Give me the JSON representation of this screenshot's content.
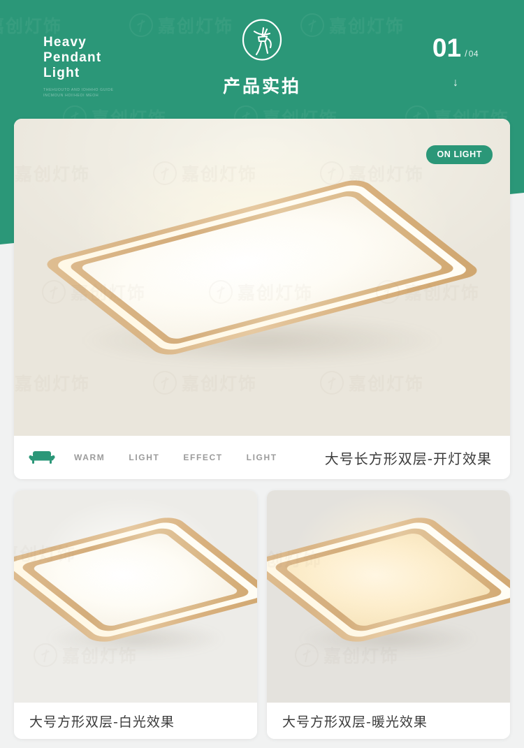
{
  "header": {
    "brand_lines": [
      "Heavy",
      "Pendant",
      "Light"
    ],
    "brand_subtitle": "THEHUOUTO AND IOHHHO GUIDE INCMOUN HOIIHEOI MEOH",
    "center_title": "产品实拍",
    "logo_icon": "circle-deer-logo-icon",
    "pager_current": "01",
    "pager_separator": "/",
    "pager_total": "04",
    "scroll_arrow": "↓",
    "bg_color": "#2b9778"
  },
  "watermark": {
    "text": "嘉创灯饰",
    "icon": "circle-deer-logo-icon"
  },
  "main_card": {
    "badge": "ON LIGHT",
    "sofa_icon": "sofa-icon",
    "keywords": [
      "WARM",
      "LIGHT",
      "EFFECT",
      "LIGHT"
    ],
    "caption": "大号长方形双层-开灯效果",
    "lamp_type": "rectangular-double-layer-wood-ceiling-lamp",
    "light_state": "on"
  },
  "gallery": [
    {
      "caption": "大号方形双层-白光效果",
      "lamp_type": "square-double-layer-wood-ceiling-lamp",
      "light_tone": "white"
    },
    {
      "caption": "大号方形双层-暖光效果",
      "lamp_type": "square-double-layer-wood-ceiling-lamp",
      "light_tone": "warm"
    }
  ]
}
